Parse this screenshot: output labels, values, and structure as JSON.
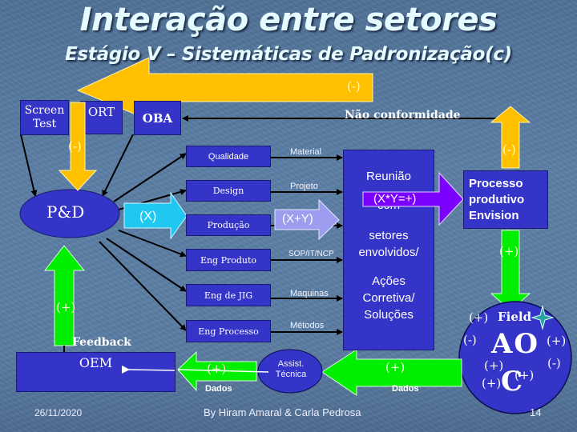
{
  "header": {
    "title": "Interação entre setores",
    "subtitle": "Estágio V – Sistemáticas de Padronização(c)"
  },
  "colors": {
    "box_fill": "#3434c8",
    "yellow_arrow": "#ffc000",
    "green_arrow": "#00ee00",
    "cyan_arrow": "#1fc8f0",
    "lavender_arrow": "#9d9df0",
    "purple_arrow": "#7a00ff"
  },
  "top_arrow": {
    "sign": "(-)"
  },
  "top_left_boxes": {
    "screen_test": "Screen Test",
    "ort": "ORT",
    "oba": "OBA"
  },
  "nonconformity_label": "Não conformidade",
  "left_down_arrow": {
    "sign": "(-)"
  },
  "pd": {
    "label": "P&D"
  },
  "x_arrow": {
    "label": "(X)"
  },
  "xy_arrow": {
    "label": "(X+Y)"
  },
  "xy_product_arrow": {
    "label": "(X*Y=+)"
  },
  "departments": [
    {
      "name": "Qualidade",
      "output": "Material"
    },
    {
      "name": "Design",
      "output": "Projeto"
    },
    {
      "name": "Produção",
      "output": ""
    },
    {
      "name": "Eng Produto",
      "output": "SOP/IT/NCP"
    },
    {
      "name": "Eng de JIG",
      "output": "Maquinas"
    },
    {
      "name": "Eng Processo",
      "output": "Métodos"
    }
  ],
  "meeting_box": {
    "line1": "Reunião",
    "line2": "com",
    "line3": "setores",
    "line4": "envolvidos/",
    "line5": "Ações",
    "line6": "Corretiva/",
    "line7": "Soluções"
  },
  "process_box": {
    "line1": "Processo",
    "line2": "produtivo",
    "line3": "Envision"
  },
  "right_up_arrow": {
    "sign": "(-)"
  },
  "right_down_arrow": {
    "sign": "(+)"
  },
  "field_circle": {
    "field_sign": "(+)",
    "field_label": "Field",
    "ao_label": "AO",
    "left_sign": "(-)",
    "right_sign": "(+)",
    "lower_left_sign": "(+)",
    "lower_right_sign": "(-)",
    "c_label": "C",
    "c_left_sign": "(+)",
    "c_right_sign": "(+)"
  },
  "left_up_arrow": {
    "sign": "(+)"
  },
  "feedback_label": "Feedback",
  "oem": {
    "label": "OEM"
  },
  "assist": {
    "line1": "Assist.",
    "line2": "Técnica"
  },
  "bottom_left_arrow": {
    "sign": "(+)",
    "caption": "Dados"
  },
  "bottom_right_arrow": {
    "sign": "(+)",
    "caption": "Dados"
  },
  "footer": {
    "date": "26/11/2020",
    "authors": "By Hiram Amaral & Carla Pedrosa",
    "page_number": "14"
  }
}
